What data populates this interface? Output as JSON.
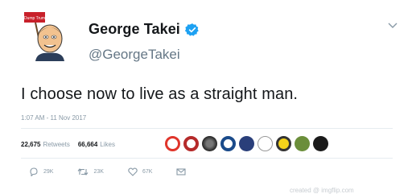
{
  "user": {
    "display_name": "George Takei",
    "handle": "@GeorgeTakei",
    "avatar_sign": "Dump Trum"
  },
  "tweet": {
    "text": "I choose now to live as a straight man.",
    "timestamp": "1:07 AM - 11 Nov 2017"
  },
  "stats": {
    "retweets_count": "22,675",
    "retweets_label": "Retweets",
    "likes_count": "66,664",
    "likes_label": "Likes"
  },
  "actions": {
    "replies": "29K",
    "retweets": "23K",
    "likes": "67K"
  },
  "colors": {
    "verified": "#1da1f2",
    "text": "#14171a",
    "muted": "#657786"
  },
  "watermark": "created @ imgflip.com"
}
